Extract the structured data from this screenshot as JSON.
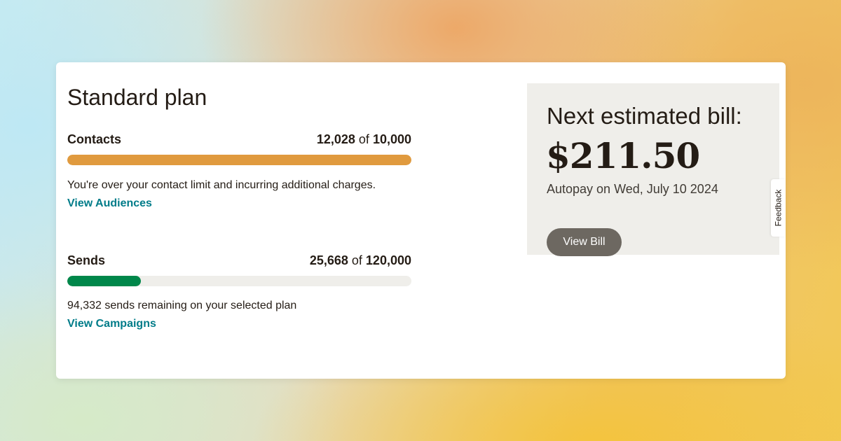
{
  "plan": {
    "title": "Standard plan"
  },
  "contacts": {
    "label": "Contacts",
    "used": "12,028",
    "of": "of",
    "limit": "10,000",
    "fill_fraction": 1.0,
    "bar_color": "#e09a3e",
    "message": "You're over your contact limit and incurring additional charges.",
    "link": "View Audiences"
  },
  "sends": {
    "label": "Sends",
    "used": "25,668",
    "of": "of",
    "limit": "120,000",
    "fill_fraction": 0.214,
    "bar_color": "#00874a",
    "message": "94,332 sends remaining on your selected plan",
    "link": "View Campaigns"
  },
  "bill": {
    "heading": "Next estimated bill:",
    "amount": "$211.50",
    "autopay": "Autopay on Wed, July 10 2024",
    "button": "View Bill"
  },
  "feedback": {
    "label": "Feedback"
  },
  "colors": {
    "link": "#007c89",
    "track": "#efeeea",
    "button": "#6d6861"
  }
}
